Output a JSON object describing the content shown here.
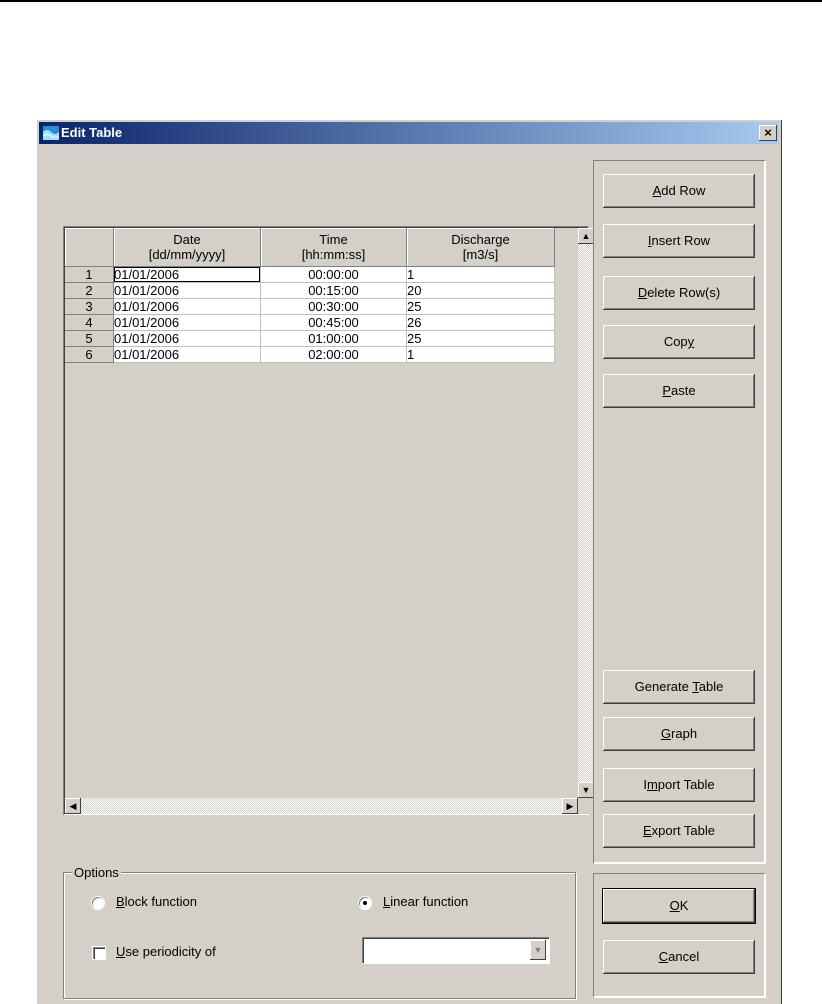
{
  "window": {
    "title": "Edit Table",
    "close_label": "×"
  },
  "table": {
    "columns": [
      {
        "line1": "Date",
        "line2": "[dd/mm/yyyy]"
      },
      {
        "line1": "Time",
        "line2": "[hh:mm:ss]"
      },
      {
        "line1": "Discharge",
        "line2": "[m3/s]"
      }
    ],
    "rows": [
      {
        "n": "1",
        "date": "01/01/2006",
        "time": "00:00:00",
        "discharge": "1"
      },
      {
        "n": "2",
        "date": "01/01/2006",
        "time": "00:15:00",
        "discharge": "20"
      },
      {
        "n": "3",
        "date": "01/01/2006",
        "time": "00:30:00",
        "discharge": "25"
      },
      {
        "n": "4",
        "date": "01/01/2006",
        "time": "00:45:00",
        "discharge": "26"
      },
      {
        "n": "5",
        "date": "01/01/2006",
        "time": "01:00:00",
        "discharge": "25"
      },
      {
        "n": "6",
        "date": "01/01/2006",
        "time": "02:00:00",
        "discharge": "1"
      }
    ],
    "selected_cell": "row 1 date"
  },
  "buttons": {
    "add_row": {
      "pre": "",
      "key": "A",
      "post": "dd Row"
    },
    "insert_row": {
      "pre": "",
      "key": "I",
      "post": "nsert Row"
    },
    "delete_rows": {
      "pre": "",
      "key": "D",
      "post": "elete Row(s)"
    },
    "copy": {
      "pre": "Cop",
      "key": "y",
      "post": ""
    },
    "paste": {
      "pre": "",
      "key": "P",
      "post": "aste"
    },
    "generate_table": {
      "pre": "Generate ",
      "key": "T",
      "post": "able"
    },
    "graph": {
      "pre": "",
      "key": "G",
      "post": "raph"
    },
    "import_table": {
      "pre": "I",
      "key": "m",
      "post": "port Table"
    },
    "export_table": {
      "pre": "",
      "key": "E",
      "post": "xport Table"
    },
    "ok": {
      "pre": "",
      "key": "O",
      "post": "K"
    },
    "cancel": {
      "pre": "",
      "key": "C",
      "post": "ancel"
    }
  },
  "options": {
    "legend": "Options",
    "block": {
      "pre": "",
      "key": "B",
      "post": "lock function",
      "checked": false
    },
    "linear": {
      "pre": "",
      "key": "L",
      "post": "inear function",
      "checked": true
    },
    "periodicity": {
      "pre": "",
      "key": "U",
      "post": "se periodicity of",
      "checked": false
    },
    "period_value": ""
  },
  "colors": {
    "face": "#d4d0c8",
    "title_start": "#0a246a",
    "title_end": "#a6caf0"
  },
  "icons": {
    "app": "water-icon",
    "close": "close-icon",
    "scroll_up": "triangle-up",
    "scroll_down": "triangle-down",
    "scroll_left": "triangle-left",
    "scroll_right": "triangle-right",
    "combo": "chevron-down"
  }
}
